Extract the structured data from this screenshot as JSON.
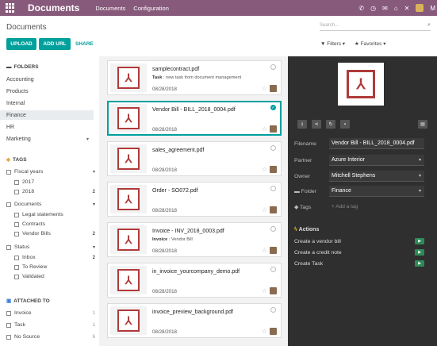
{
  "app": {
    "title": "Documents"
  },
  "top_menu": [
    "Documents",
    "Configuration"
  ],
  "top_icons": [
    "phone-icon",
    "clock-icon",
    "chat-icon",
    "home-icon",
    "close-icon"
  ],
  "top_user": "M",
  "breadcrumb": "Documents",
  "search": {
    "placeholder": "Search..."
  },
  "toolbar": {
    "upload": "UPLOAD",
    "add_url": "ADD URL",
    "share": "SHARE",
    "filters": "Filters",
    "favorites": "Favorites"
  },
  "sidebar": {
    "folders_title": "FOLDERS",
    "folders": [
      "Accounting",
      "Products",
      "Internal",
      "Finance",
      "HR",
      "Marketing"
    ],
    "tags_title": "TAGS",
    "tag_groups": [
      {
        "label": "Fiscal years",
        "items": [
          {
            "label": "2017",
            "count": ""
          },
          {
            "label": "2018",
            "count": "2"
          }
        ]
      },
      {
        "label": "Documents",
        "items": [
          {
            "label": "Legal statements",
            "count": ""
          },
          {
            "label": "Contracts",
            "count": ""
          },
          {
            "label": "Vendor Bills",
            "count": "2"
          }
        ]
      },
      {
        "label": "Status",
        "items": [
          {
            "label": "Inbox",
            "count": "2"
          },
          {
            "label": "To Review",
            "count": ""
          },
          {
            "label": "Validated",
            "count": ""
          }
        ]
      }
    ],
    "attached_title": "ATTACHED TO",
    "attached": [
      {
        "label": "Invoice",
        "count": "1"
      },
      {
        "label": "Task",
        "count": "1"
      },
      {
        "label": "No Source",
        "count": "6"
      }
    ]
  },
  "documents": [
    {
      "name": "samplecontract.pdf",
      "sub_label": "Task",
      "sub_value": " : new task from document management",
      "date": "08/28/2018",
      "selected": false
    },
    {
      "name": "Vendor Bill - BILL_2018_0004.pdf",
      "sub_label": "",
      "sub_value": "",
      "date": "08/28/2018",
      "selected": true
    },
    {
      "name": "sales_agreement.pdf",
      "sub_label": "",
      "sub_value": "",
      "date": "08/28/2018",
      "selected": false
    },
    {
      "name": "Order - SO072.pdf",
      "sub_label": "",
      "sub_value": "",
      "date": "08/28/2018",
      "selected": false
    },
    {
      "name": "Invoice - INV_2018_0003.pdf",
      "sub_label": "Invoice",
      "sub_value": " : Vendor Bill",
      "date": "08/28/2018",
      "selected": false
    },
    {
      "name": "in_invoice_yourcompany_demo.pdf",
      "sub_label": "",
      "sub_value": "",
      "date": "08/28/2018",
      "selected": false
    },
    {
      "name": "invoice_preview_background.pdf",
      "sub_label": "",
      "sub_value": "",
      "date": "08/28/2018",
      "selected": false
    }
  ],
  "inspector": {
    "fields": [
      {
        "label": "Filename",
        "value": "Vendor Bill - BILL_2018_0004.pdf"
      },
      {
        "label": "Partner",
        "value": "Azure Interior"
      },
      {
        "label": "Owner",
        "value": "Mitchell Stephens"
      },
      {
        "label": "Folder",
        "value": "Finance"
      }
    ],
    "tags_label": "Tags",
    "tags_placeholder": "+ Add a tag",
    "actions_title": "Actions",
    "actions": [
      "Create a vendor bill",
      "Create a credit note",
      "Create Task"
    ]
  },
  "colors": {
    "brand": "#875a7b",
    "accent": "#00a09d",
    "inspector_bg": "#2f2f2f",
    "action_green": "#2e8b57"
  }
}
